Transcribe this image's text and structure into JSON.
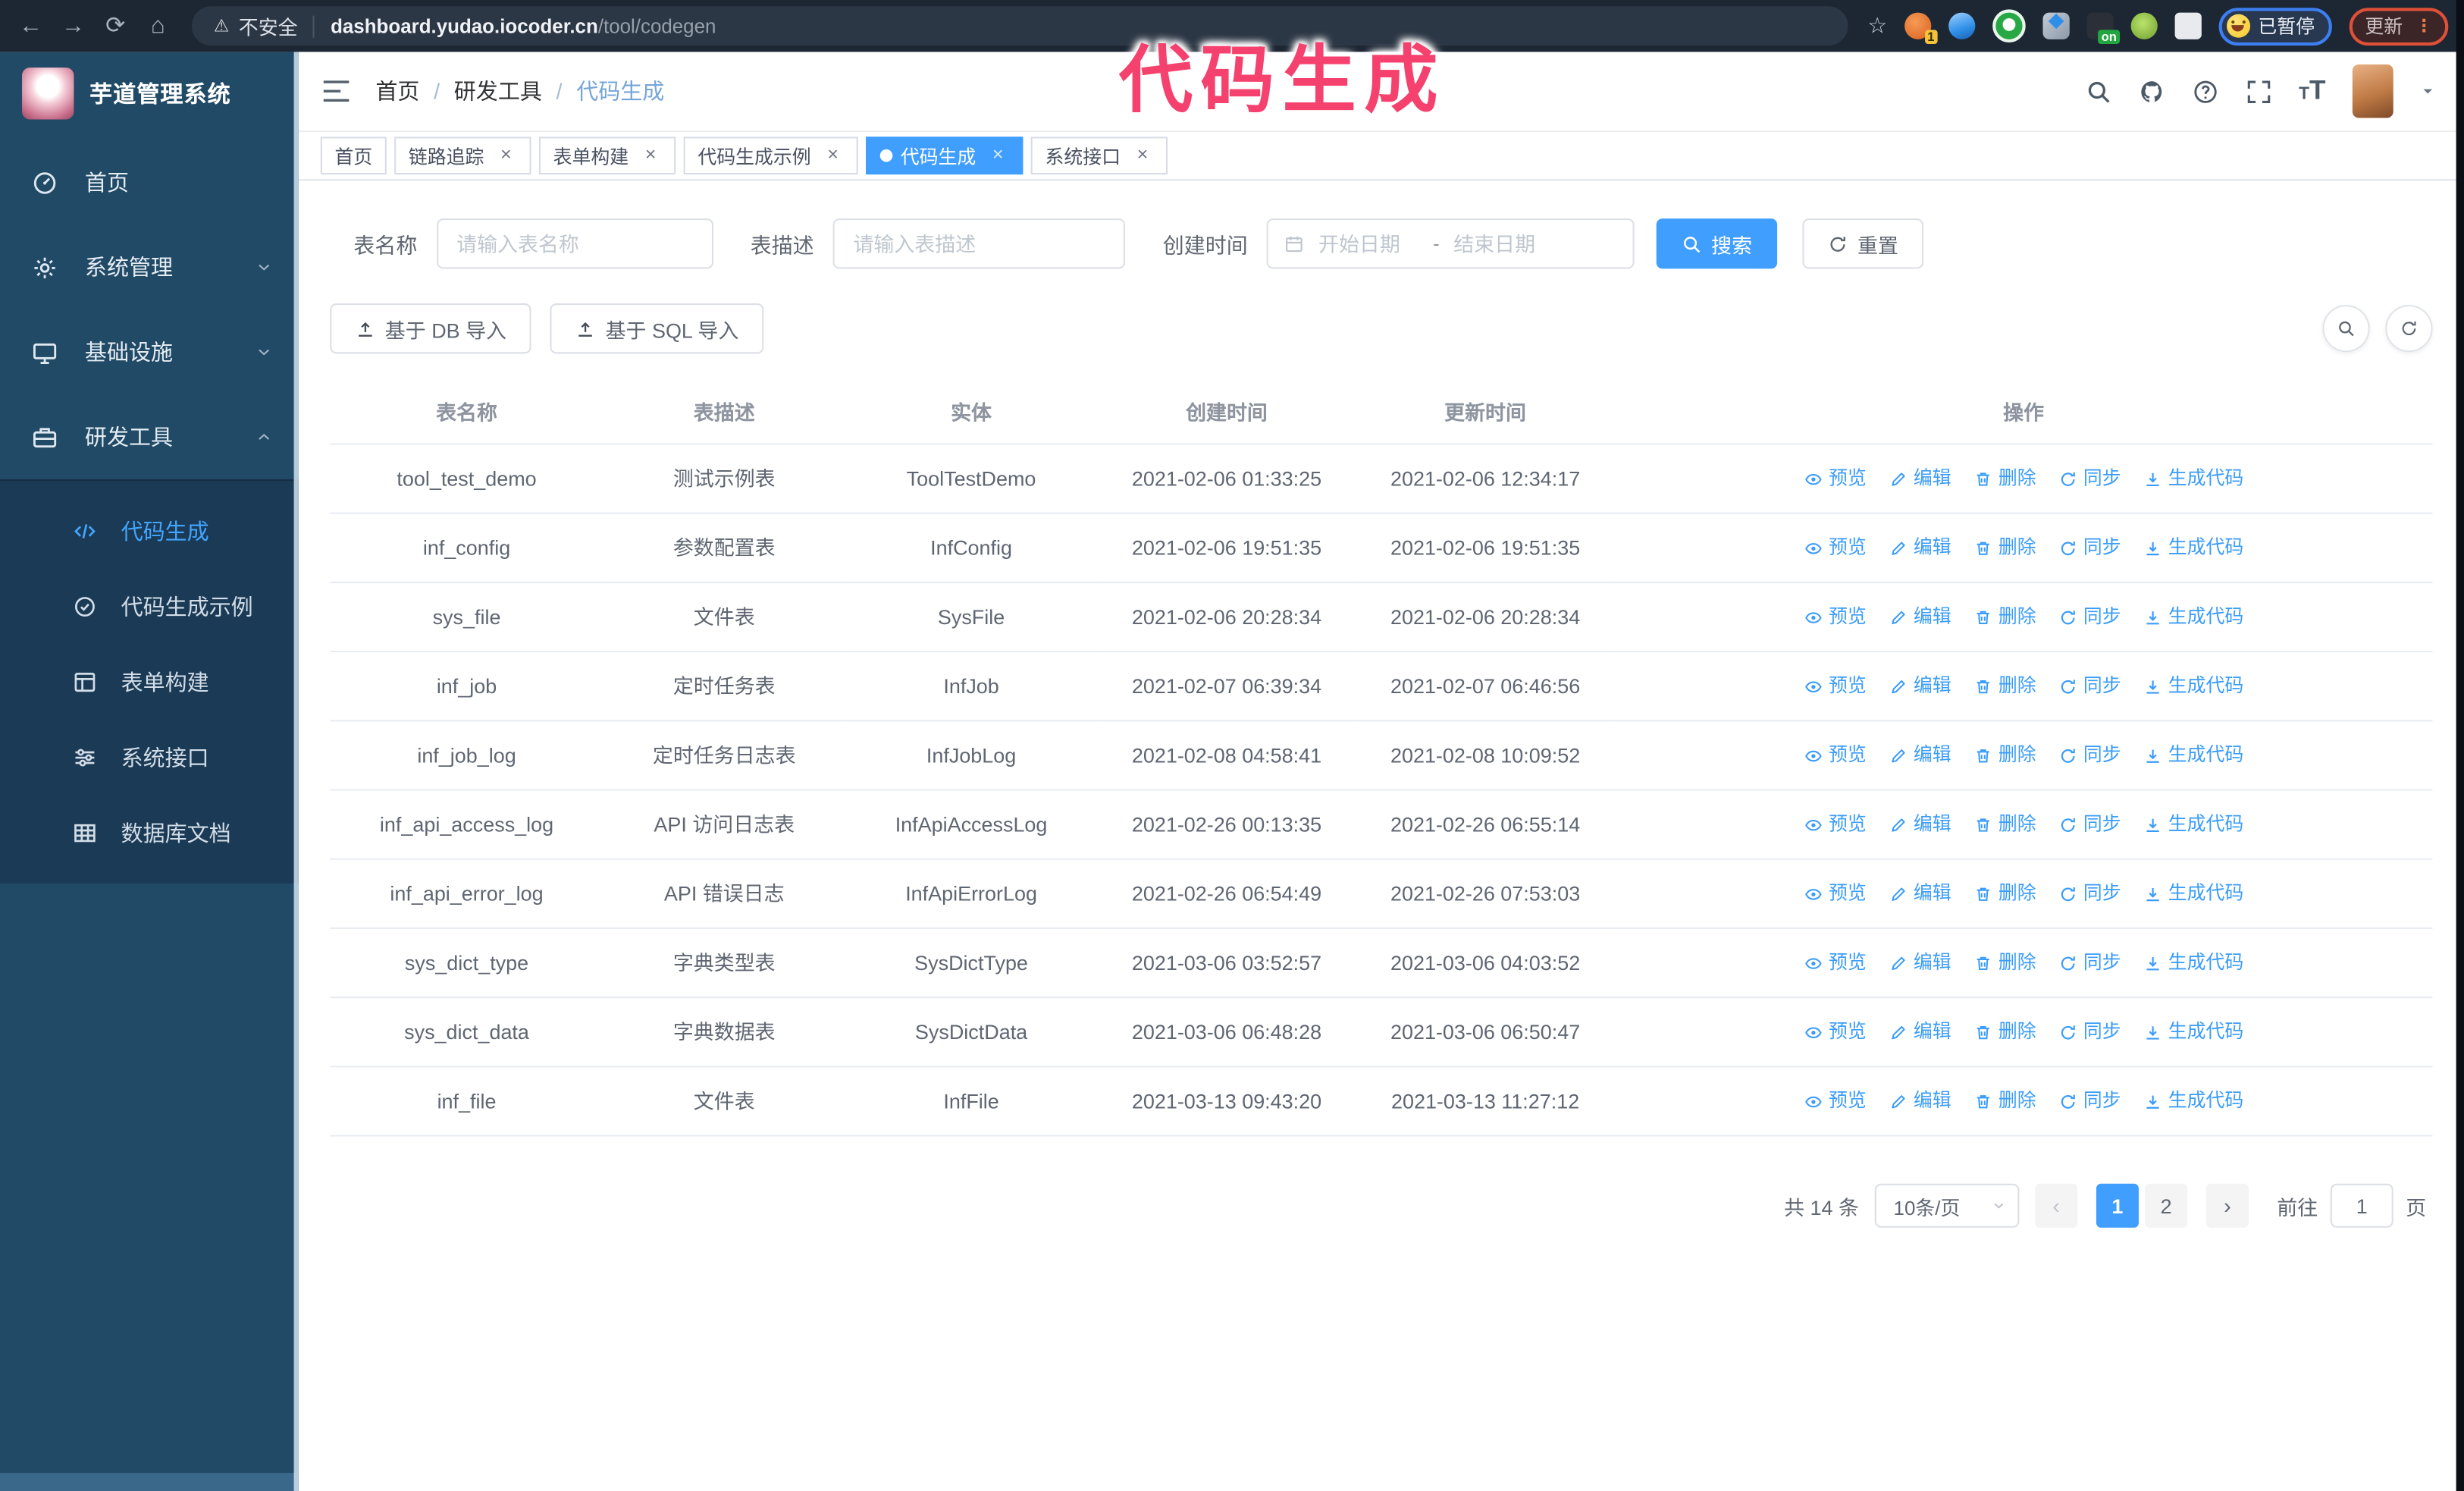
{
  "browser": {
    "not_secure": "不安全",
    "url_host": "dashboard.yudao.iocoder.cn",
    "url_path": "/tool/codegen",
    "extensions": [
      {
        "id": "ext-orange",
        "badge": "1"
      },
      {
        "id": "ext-gem",
        "badge": ""
      },
      {
        "id": "ext-green-check",
        "badge": ""
      },
      {
        "id": "ext-grid",
        "badge": ""
      },
      {
        "id": "ext-dark",
        "badge": "on"
      },
      {
        "id": "ext-green2",
        "badge": ""
      },
      {
        "id": "ext-puzzle",
        "badge": ""
      }
    ],
    "paused_badge": "已暂停",
    "update_label": "更新"
  },
  "annotation": {
    "text": "代码生成"
  },
  "sidebar": {
    "title": "芋道管理系统",
    "items": [
      {
        "id": "home",
        "label": "首页",
        "icon": "dashboard",
        "chevron": ""
      },
      {
        "id": "system-mgmt",
        "label": "系统管理",
        "icon": "gear",
        "chevron": "down"
      },
      {
        "id": "infrastructure",
        "label": "基础设施",
        "icon": "monitor",
        "chevron": "down"
      },
      {
        "id": "dev-tools",
        "label": "研发工具",
        "icon": "briefcase",
        "chevron": "up"
      }
    ],
    "subitems": [
      {
        "id": "codegen",
        "label": "代码生成",
        "icon": "code",
        "active": true
      },
      {
        "id": "codegen-example",
        "label": "代码生成示例",
        "icon": "badgecheck",
        "active": false
      },
      {
        "id": "form-builder",
        "label": "表单构建",
        "icon": "form",
        "active": false
      },
      {
        "id": "system-api",
        "label": "系统接口",
        "icon": "sliders",
        "active": false
      },
      {
        "id": "db-doc",
        "label": "数据库文档",
        "icon": "tablegrid",
        "active": false
      }
    ]
  },
  "header": {
    "breadcrumb": [
      "首页",
      "研发工具",
      "代码生成"
    ]
  },
  "tabs": [
    {
      "id": "home",
      "label": "首页",
      "active": false,
      "closable": false
    },
    {
      "id": "tracing",
      "label": "链路追踪",
      "active": false,
      "closable": true
    },
    {
      "id": "form-builder",
      "label": "表单构建",
      "active": false,
      "closable": true
    },
    {
      "id": "codegen-example",
      "label": "代码生成示例",
      "active": false,
      "closable": true
    },
    {
      "id": "codegen",
      "label": "代码生成",
      "active": true,
      "closable": true
    },
    {
      "id": "system-api",
      "label": "系统接口",
      "active": false,
      "closable": true
    }
  ],
  "filters": {
    "table_name_label": "表名称",
    "table_name_placeholder": "请输入表名称",
    "table_desc_label": "表描述",
    "table_desc_placeholder": "请输入表描述",
    "create_time_label": "创建时间",
    "start_date_placeholder": "开始日期",
    "range_separator": "-",
    "end_date_placeholder": "结束日期",
    "search_label": "搜索",
    "reset_label": "重置"
  },
  "toolbar": {
    "import_db_label": "基于 DB 导入",
    "import_sql_label": "基于 SQL 导入"
  },
  "table": {
    "columns": [
      "表名称",
      "表描述",
      "实体",
      "创建时间",
      "更新时间",
      "操作"
    ],
    "row_actions": [
      "预览",
      "编辑",
      "删除",
      "同步",
      "生成代码"
    ],
    "rows": [
      {
        "name": "tool_test_demo",
        "desc": "测试示例表",
        "entity": "ToolTestDemo",
        "created": "2021-02-06 01:33:25",
        "updated": "2021-02-06 12:34:17"
      },
      {
        "name": "inf_config",
        "desc": "参数配置表",
        "entity": "InfConfig",
        "created": "2021-02-06 19:51:35",
        "updated": "2021-02-06 19:51:35"
      },
      {
        "name": "sys_file",
        "desc": "文件表",
        "entity": "SysFile",
        "created": "2021-02-06 20:28:34",
        "updated": "2021-02-06 20:28:34"
      },
      {
        "name": "inf_job",
        "desc": "定时任务表",
        "entity": "InfJob",
        "created": "2021-02-07 06:39:34",
        "updated": "2021-02-07 06:46:56"
      },
      {
        "name": "inf_job_log",
        "desc": "定时任务日志表",
        "entity": "InfJobLog",
        "created": "2021-02-08 04:58:41",
        "updated": "2021-02-08 10:09:52"
      },
      {
        "name": "inf_api_access_log",
        "desc": "API 访问日志表",
        "entity": "InfApiAccessLog",
        "created": "2021-02-26 00:13:35",
        "updated": "2021-02-26 06:55:14"
      },
      {
        "name": "inf_api_error_log",
        "desc": "API 错误日志",
        "entity": "InfApiErrorLog",
        "created": "2021-02-26 06:54:49",
        "updated": "2021-02-26 07:53:03"
      },
      {
        "name": "sys_dict_type",
        "desc": "字典类型表",
        "entity": "SysDictType",
        "created": "2021-03-06 03:52:57",
        "updated": "2021-03-06 04:03:52"
      },
      {
        "name": "sys_dict_data",
        "desc": "字典数据表",
        "entity": "SysDictData",
        "created": "2021-03-06 06:48:28",
        "updated": "2021-03-06 06:50:47"
      },
      {
        "name": "inf_file",
        "desc": "文件表",
        "entity": "InfFile",
        "created": "2021-03-13 09:43:20",
        "updated": "2021-03-13 11:27:12"
      }
    ]
  },
  "pagination": {
    "total_text": "共 14 条",
    "page_size_text": "10条/页",
    "pages": [
      "1",
      "2"
    ],
    "active_page": "1",
    "goto_label": "前往",
    "goto_value": "1",
    "page_unit": "页"
  },
  "colors": {
    "accent": "#409eff",
    "annotation": "#f5416d",
    "sidebar_bg": "#214a66",
    "submenu_bg": "#1b3a55",
    "chrome_bg": "#1d2734"
  }
}
